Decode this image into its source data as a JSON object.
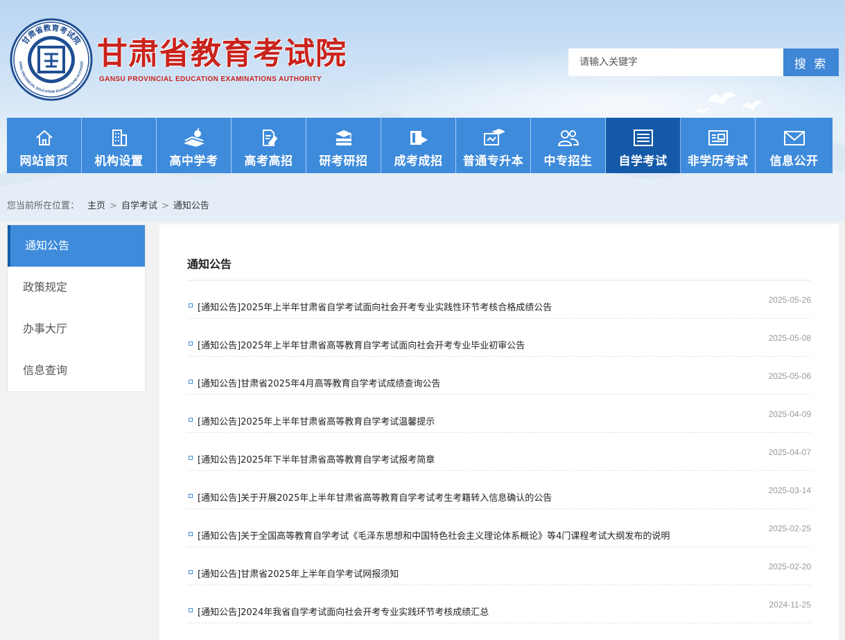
{
  "header": {
    "logo_cn": "甘肃省教育考试院",
    "logo_en": "GANSU PROVINCIAL EDUCATION EXAMINATIONS AUTHORITY",
    "emblem_ring_top": "甘肃省教育考试院",
    "emblem_ring_bottom": "GANSU PROVINCIAL EDUCATION EXAMINATIONS AUTHORITY"
  },
  "search": {
    "placeholder": "请输入关键字",
    "button_label": "搜 索"
  },
  "nav": {
    "items": [
      {
        "label": "网站首页",
        "icon": "home-icon"
      },
      {
        "label": "机构设置",
        "icon": "building-icon"
      },
      {
        "label": "高中学考",
        "icon": "books-apple-icon"
      },
      {
        "label": "高考高招",
        "icon": "document-pen-icon"
      },
      {
        "label": "研考研招",
        "icon": "book-stack-icon"
      },
      {
        "label": "成考成招",
        "icon": "book-flag-icon"
      },
      {
        "label": "普通专升本",
        "icon": "graduation-board-icon"
      },
      {
        "label": "中专招生",
        "icon": "people-icon"
      },
      {
        "label": "自学考试",
        "icon": "news-list-icon",
        "active": true
      },
      {
        "label": "非学历考试",
        "icon": "id-card-icon"
      },
      {
        "label": "信息公开",
        "icon": "mail-icon"
      }
    ]
  },
  "breadcrumb": {
    "prefix": "您当前所在位置：",
    "items": [
      "主页",
      "自学考试",
      "通知公告"
    ],
    "separator": ">"
  },
  "sidebar": {
    "items": [
      {
        "label": "通知公告",
        "active": true
      },
      {
        "label": "政策规定"
      },
      {
        "label": "办事大厅"
      },
      {
        "label": "信息查询"
      }
    ]
  },
  "main": {
    "title": "通知公告",
    "news": [
      {
        "title": "[通知公告]2025年上半年甘肃省自学考试面向社会开考专业实践性环节考核合格成绩公告",
        "date": "2025-05-26"
      },
      {
        "title": "[通知公告]2025年上半年甘肃省高等教育自学考试面向社会开考专业毕业初审公告",
        "date": "2025-05-08"
      },
      {
        "title": "[通知公告]甘肃省2025年4月高等教育自学考试成绩查询公告",
        "date": "2025-05-06"
      },
      {
        "title": "[通知公告]2025年上半年甘肃省高等教育自学考试温馨提示",
        "date": "2025-04-09"
      },
      {
        "title": "[通知公告]2025年下半年甘肃省高等教育自学考试报考简章",
        "date": "2025-04-07"
      },
      {
        "title": "[通知公告]关于开展2025年上半年甘肃省高等教育自学考试考生考籍转入信息确认的公告",
        "date": "2025-03-14"
      },
      {
        "title": "[通知公告]关于全国高等教育自学考试《毛泽东思想和中国特色社会主义理论体系概论》等4门课程考试大纲发布的说明",
        "date": "2025-02-25"
      },
      {
        "title": "[通知公告]甘肃省2025年上半年自学考试网报须知",
        "date": "2025-02-20"
      },
      {
        "title": "[通知公告]2024年我省自学考试面向社会开考专业实践环节考核成绩汇总",
        "date": "2024-11-25"
      }
    ]
  },
  "colors": {
    "nav_blue": "#3e8bdc",
    "nav_active": "#155aa8",
    "logo_red": "#c9231d",
    "search_button": "#3f86d6"
  }
}
